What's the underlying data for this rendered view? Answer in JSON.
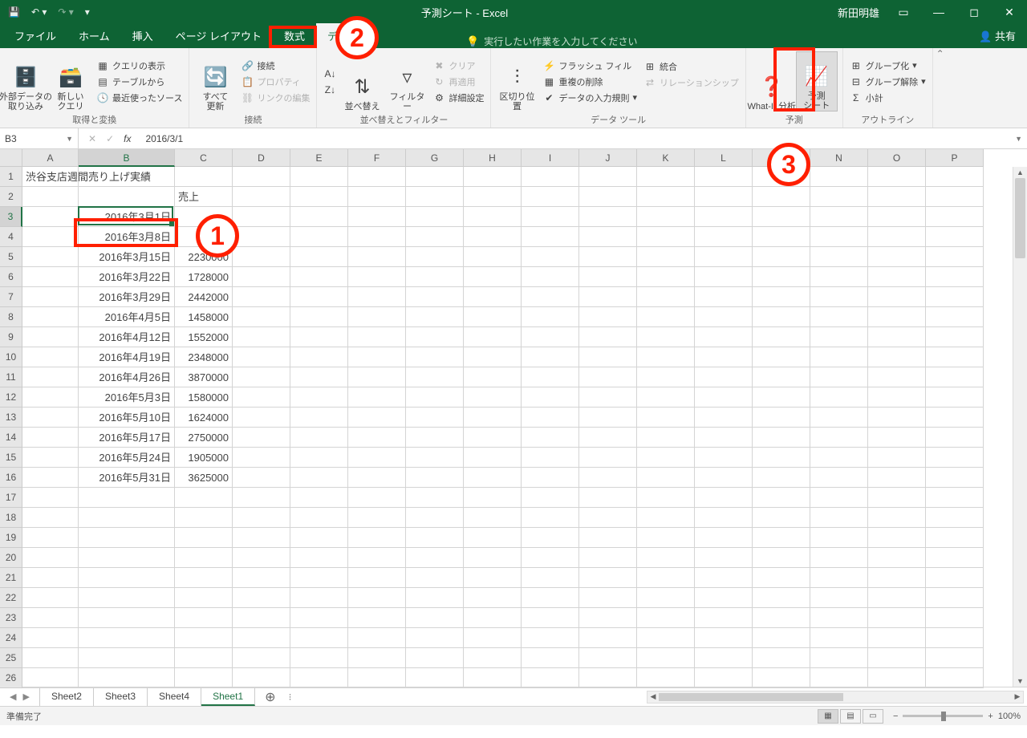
{
  "titlebar": {
    "title": "予測シート - Excel",
    "user": "新田明雄"
  },
  "tabs": {
    "file": "ファイル",
    "home": "ホーム",
    "insert": "挿入",
    "pagelayout": "ページ レイアウト",
    "formulas": "数式",
    "data": "データ",
    "tellme_placeholder": "実行したい作業を入力してください",
    "share": "共有"
  },
  "ribbon": {
    "external_data": "外部データの\n取り込み",
    "new_query": "新しい\nクエリ",
    "show_queries": "クエリの表示",
    "from_table": "テーブルから",
    "recent_sources": "最近使ったソース",
    "group_transform": "取得と変換",
    "refresh_all": "すべて\n更新",
    "connections": "接続",
    "properties": "プロパティ",
    "edit_links": "リンクの編集",
    "group_connections": "接続",
    "sort_az": "A→Z",
    "sort_za": "Z→A",
    "sort": "並べ替え",
    "filter": "フィルター",
    "clear": "クリア",
    "reapply": "再適用",
    "advanced": "詳細設定",
    "group_sort": "並べ替えとフィルター",
    "text_to_columns": "区切り位置",
    "flash_fill": "フラッシュ フィル",
    "remove_dupes": "重複の削除",
    "data_validation": "データの入力規則",
    "consolidate": "統合",
    "relationships": "リレーションシップ",
    "group_datatools": "データ ツール",
    "whatif": "What-If 分析",
    "forecast_sheet": "予測\nシート",
    "group_forecast": "予測",
    "group": "グループ化",
    "ungroup": "グループ解除",
    "subtotal": "小計",
    "group_outline": "アウトライン"
  },
  "fbar": {
    "name": "B3",
    "formula": "2016/3/1"
  },
  "columns": [
    "A",
    "B",
    "C",
    "D",
    "E",
    "F",
    "G",
    "H",
    "I",
    "J",
    "K",
    "L",
    "M",
    "N",
    "O",
    "P"
  ],
  "rows_count": 26,
  "active_col": 1,
  "active_row": 2,
  "cells": {
    "A1": "渋谷支店週間売り上げ実績",
    "C2": "売上",
    "B3": "2016年3月1日",
    "B4": "2016年3月8日",
    "B5": "2016年3月15日",
    "C5": "2230000",
    "B6": "2016年3月22日",
    "C6": "1728000",
    "B7": "2016年3月29日",
    "C7": "2442000",
    "B8": "2016年4月5日",
    "C8": "1458000",
    "B9": "2016年4月12日",
    "C9": "1552000",
    "B10": "2016年4月19日",
    "C10": "2348000",
    "B11": "2016年4月26日",
    "C11": "3870000",
    "B12": "2016年5月3日",
    "C12": "1580000",
    "B13": "2016年5月10日",
    "C13": "1624000",
    "B14": "2016年5月17日",
    "C14": "2750000",
    "B15": "2016年5月24日",
    "C15": "1905000",
    "B16": "2016年5月31日",
    "C16": "3625000"
  },
  "sheets": {
    "tabs": [
      "Sheet2",
      "Sheet3",
      "Sheet4",
      "Sheet1"
    ],
    "active": 3
  },
  "status": {
    "ready": "準備完了",
    "zoom": "100%"
  },
  "annotations": {
    "c1": "1",
    "c2": "2",
    "c3": "3"
  }
}
